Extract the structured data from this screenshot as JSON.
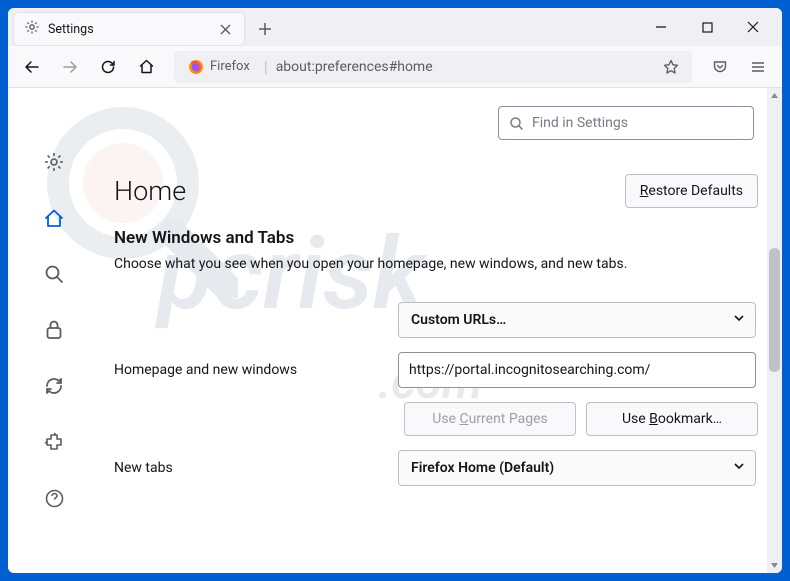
{
  "tab": {
    "title": "Settings"
  },
  "address": {
    "identity": "Firefox",
    "url": "about:preferences#home"
  },
  "search": {
    "placeholder": "Find in Settings"
  },
  "page": {
    "title": "Home",
    "restore_defaults": "Restore Defaults",
    "restore_defaults_u": "R"
  },
  "section": {
    "title": "New Windows and Tabs",
    "desc": "Choose what you see when you open your homepage, new windows, and new tabs."
  },
  "rows": {
    "homepage": {
      "label": "Homepage and new windows",
      "select": "Custom URLs…",
      "value": "https://portal.incognitosearching.com/"
    },
    "newtabs": {
      "label": "New tabs",
      "select": "Firefox Home (Default)"
    }
  },
  "buttons": {
    "use_pages": "Use Current Pages",
    "use_pages_u": "C",
    "use_bookmark": "Use Bookmark…",
    "use_bookmark_u": "B"
  }
}
